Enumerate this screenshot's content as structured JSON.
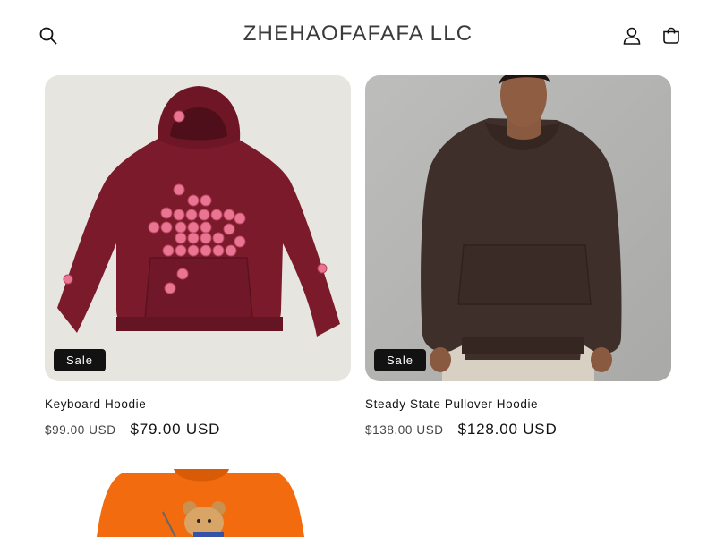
{
  "header": {
    "store_name": "ZHEHAOFAFAFA LLC",
    "icons": [
      "search-icon",
      "account-icon",
      "cart-icon"
    ]
  },
  "products": [
    {
      "title": "Keyboard Hoodie",
      "compare_price": "$99.00 USD",
      "sale_price": "$79.00 USD",
      "badge": "Sale",
      "image_desc": "maroon hoodie with pink ball prints",
      "image_bg": "#e7e5df",
      "garment_color": "#7b1a2b"
    },
    {
      "title": "Steady State Pullover Hoodie",
      "compare_price": "$138.00 USD",
      "sale_price": "$128.00 USD",
      "badge": "Sale",
      "image_desc": "man wearing dark brown hoodie",
      "image_bg": "#b4b4b2",
      "garment_color": "#3f2f2a"
    },
    {
      "image_desc": "orange hoodie with teddy bear print",
      "image_bg": "#ffffff",
      "garment_color": "#f26b0f"
    }
  ]
}
